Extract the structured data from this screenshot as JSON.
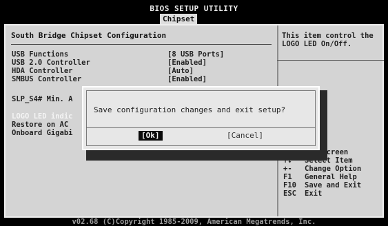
{
  "header": {
    "title": "BIOS SETUP UTILITY",
    "active_tab": "Chipset"
  },
  "main": {
    "page_title": "South Bridge Chipset Configuration",
    "settings": [
      {
        "label": "USB Functions",
        "value": "[8 USB Ports]"
      },
      {
        "label": "USB 2.0 Controller",
        "value": "[Enabled]"
      },
      {
        "label": "HDA Controller",
        "value": "[Auto]"
      },
      {
        "label": "SMBUS Controller",
        "value": "[Enabled]"
      },
      {
        "label": "SLP_S4# Min. A",
        "value": ""
      },
      {
        "label": "LOGO LED indic",
        "value": ""
      },
      {
        "label": "Restore on AC",
        "value": ""
      },
      {
        "label": "Onboard Gigabi",
        "value": ""
      }
    ]
  },
  "help": {
    "text": "This item control the LOGO LED On/Off.",
    "keys": [
      {
        "key": "",
        "desc": "ect Screen"
      },
      {
        "key": "↑↓",
        "desc": "Select Item"
      },
      {
        "key": "+-",
        "desc": "Change Option"
      },
      {
        "key": "F1",
        "desc": "General Help"
      },
      {
        "key": "F10",
        "desc": "Save and Exit"
      },
      {
        "key": "ESC",
        "desc": "Exit"
      }
    ]
  },
  "dialog": {
    "message": "Save configuration changes and exit setup?",
    "ok_label": "[Ok]",
    "cancel_label": "[Cancel]"
  },
  "footer": {
    "copyright": "v02.68 (C)Copyright 1985-2009, American Megatrends, Inc."
  }
}
